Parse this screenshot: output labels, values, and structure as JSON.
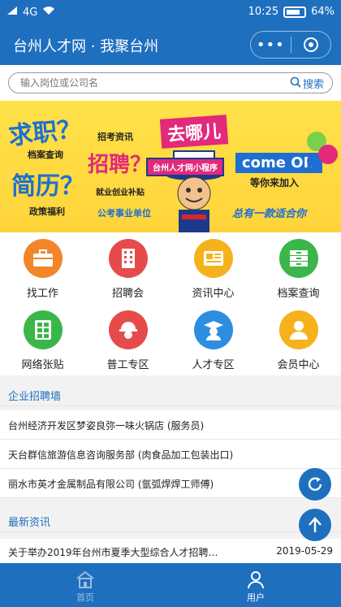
{
  "status_bar": {
    "carrier": "4G",
    "time": "10:25",
    "battery": "64%"
  },
  "app": {
    "title": "台州人才网 · 我聚台州",
    "more_label": "•••"
  },
  "search": {
    "placeholder": "输入岗位或公司名",
    "button_label": "搜索"
  },
  "banner": {
    "texts": [
      "求职？",
      "招考资讯",
      "档案查询",
      "简历？",
      "政策福利",
      "招聘？",
      "就业创业补贴",
      "公考事业单位",
      "去哪儿",
      "台州人才网小程序",
      "come ON",
      "等你来加入",
      "总有一款适合你"
    ],
    "bg_color": "#ffdc43"
  },
  "grid": {
    "items": [
      {
        "label": "找工作",
        "icon": "briefcase-icon",
        "color": "#f2862a"
      },
      {
        "label": "招聘会",
        "icon": "building-icon",
        "color": "#e64b4b"
      },
      {
        "label": "资讯中心",
        "icon": "newspaper-icon",
        "color": "#f6b21d"
      },
      {
        "label": "档案查询",
        "icon": "archive-icon",
        "color": "#3bb64a"
      },
      {
        "label": "网络张贴",
        "icon": "grid-board-icon",
        "color": "#3bb64a"
      },
      {
        "label": "普工专区",
        "icon": "worker-helmet-icon",
        "color": "#e64b4b"
      },
      {
        "label": "人才专区",
        "icon": "graduate-icon",
        "color": "#2d8ee0"
      },
      {
        "label": "会员中心",
        "icon": "member-icon",
        "color": "#f6b21d"
      }
    ]
  },
  "recruit": {
    "section_title": "企业招聘墙",
    "items": [
      "台州经济开发区梦姿良弥一味火锅店 (服务员)",
      "天台群信旅游信息咨询服务部 (肉食品加工包装出口)",
      "丽水市英才金属制品有限公司 (氩弧焊焊工师傅)"
    ]
  },
  "news": {
    "section_title": "最新资讯",
    "items": [
      {
        "title": "关于举办2019年台州市夏季大型综合人才招聘…",
        "date": "2019-05-29"
      }
    ]
  },
  "tabbar": {
    "home_label": "首页",
    "user_label": "用户"
  },
  "colors": {
    "primary": "#1f6fbf"
  }
}
